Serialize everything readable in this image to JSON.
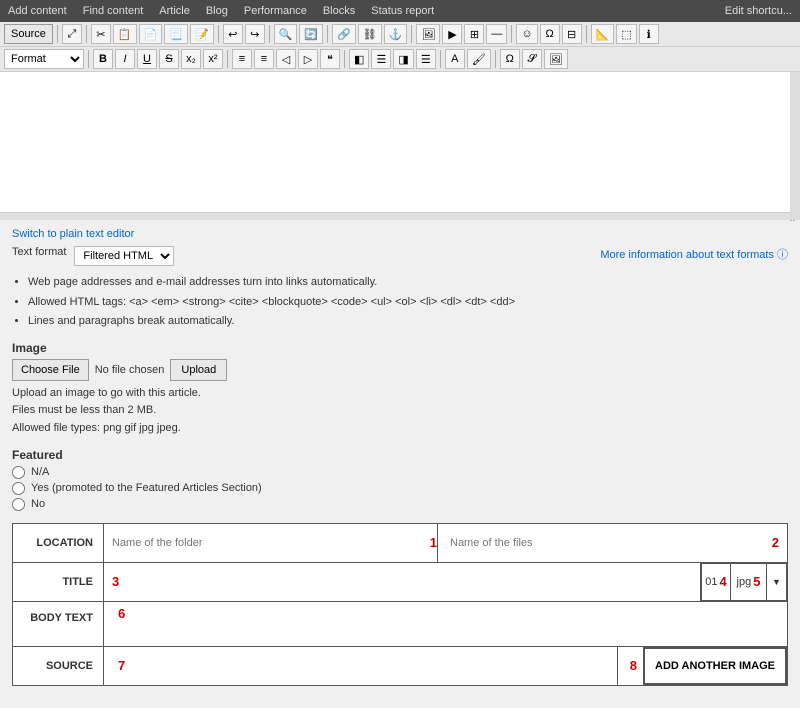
{
  "topMenu": {
    "items": [
      "Add content",
      "Find content",
      "Article",
      "Blog",
      "Performance",
      "Blocks",
      "Status report"
    ],
    "editShortcut": "Edit shortcu..."
  },
  "toolbar1": {
    "sourceBtn": "Source",
    "buttons": [
      "⊞",
      "⊟",
      "📋",
      "📋",
      "⎘",
      "↩",
      "↪",
      "🔍",
      "¶",
      "Ω",
      "🔗",
      "🔗",
      "🖼",
      "🎬",
      "📊",
      "⬛",
      "—",
      "🔢",
      "🔤",
      "🅰",
      "🅱",
      "✖",
      "📌",
      "❓"
    ]
  },
  "toolbar2": {
    "formatLabel": "Format",
    "boldBtn": "B",
    "italicBtn": "I",
    "underlineBtn": "U",
    "strikeBtn": "S",
    "subBtn": "x₂",
    "supBtn": "x²",
    "listBtns": [
      "≡",
      "≡",
      "◁",
      "▷",
      "¶",
      "\""
    ],
    "alignBtns": [
      "◧",
      "☰",
      "◨",
      "⬛",
      "⬛",
      "⬛",
      "↔",
      "—"
    ],
    "moreBtns": [
      "Ω",
      "Ω",
      "🖼"
    ]
  },
  "switchLink": "Switch to plain text editor",
  "textFormat": {
    "label": "Text format",
    "value": "Filtered HTML",
    "moreInfoLink": "More information about text formats ⓘ",
    "notes": [
      "Web page addresses and e-mail addresses turn into links automatically.",
      "Allowed HTML tags: <a> <em> <strong> <cite> <blockquote> <code> <ul> <ol> <li> <dl> <dt> <dd>",
      "Lines and paragraphs break automatically."
    ]
  },
  "imageSection": {
    "label": "Image",
    "chooseFileBtn": "Choose File",
    "noFileText": "No file chosen",
    "uploadBtn": "Upload",
    "note1": "Upload an image to go with this article.",
    "note2": "Files must be less than 2 MB.",
    "note3": "Allowed file types: png gif jpg jpeg."
  },
  "featuredSection": {
    "label": "Featured",
    "options": [
      "N/A",
      "Yes (promoted to the Featured Articles Section)",
      "No"
    ]
  },
  "locationTable": {
    "locationLabel": "LOCATION",
    "folderPlaceholder": "Name of the folder",
    "folderNum": "1",
    "filesPlaceholder": "Name of the files",
    "filesNum": "2",
    "titleLabel": "TITLE",
    "titleNum": "3",
    "numBoxValue": "01",
    "numBoxNum": "4",
    "extValue": "jpg",
    "extNum": "5",
    "dropdownArrow": "▼",
    "bodyTextLabel": "BODY TEXT",
    "bodyTextNum": "6",
    "sourceLabel": "SOURCE",
    "sourceNum": "7",
    "addImageNum": "8",
    "addImageBtn": "ADD ANOTHER IMAGE"
  }
}
